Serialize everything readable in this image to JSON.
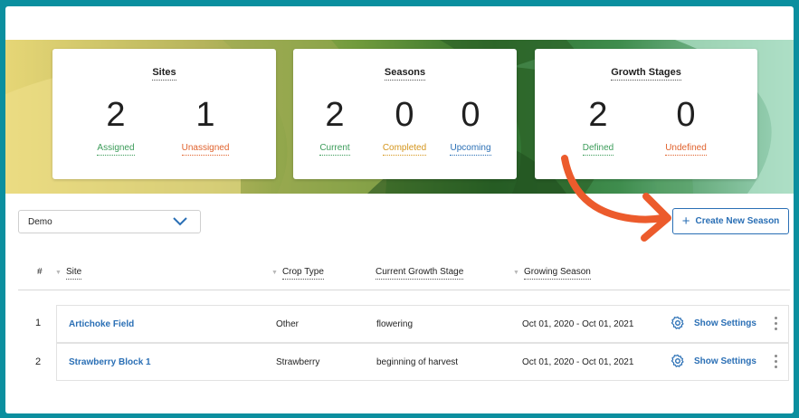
{
  "cards": [
    {
      "title": "Sites",
      "stats": [
        {
          "value": "2",
          "label": "Assigned",
          "color": "#3c9c5a"
        },
        {
          "value": "1",
          "label": "Unassigned",
          "color": "#e0622d"
        }
      ]
    },
    {
      "title": "Seasons",
      "stats": [
        {
          "value": "2",
          "label": "Current",
          "color": "#3c9c5a"
        },
        {
          "value": "0",
          "label": "Completed",
          "color": "#d4951c"
        },
        {
          "value": "0",
          "label": "Upcoming",
          "color": "#2a6fb5"
        }
      ]
    },
    {
      "title": "Growth Stages",
      "stats": [
        {
          "value": "2",
          "label": "Defined",
          "color": "#3c9c5a"
        },
        {
          "value": "0",
          "label": "Undefined",
          "color": "#e0622d"
        }
      ]
    }
  ],
  "filter": {
    "selected": "Demo",
    "icon": "chevron-down-icon"
  },
  "create_button": {
    "label": "Create New Season",
    "icon": "plus-icon"
  },
  "table": {
    "headers": {
      "index": "#",
      "site": "Site",
      "crop_type": "Crop Type",
      "growth_stage": "Current Growth Stage",
      "growing_season": "Growing Season"
    },
    "rows": [
      {
        "num": "1",
        "site": "Artichoke Field",
        "crop_type": "Other",
        "growth_stage": "flowering",
        "growing_season": "Oct 01, 2020 - Oct 01, 2021",
        "settings_label": "Show Settings"
      },
      {
        "num": "2",
        "site": "Strawberry Block 1",
        "crop_type": "Strawberry",
        "growth_stage": "beginning of harvest",
        "growing_season": "Oct 01, 2020 - Oct 01, 2021",
        "settings_label": "Show Settings"
      }
    ]
  },
  "colors": {
    "frame": "#0b8f9f",
    "accent_blue": "#2a6fb5",
    "annotation_arrow": "#ec5b2c"
  }
}
